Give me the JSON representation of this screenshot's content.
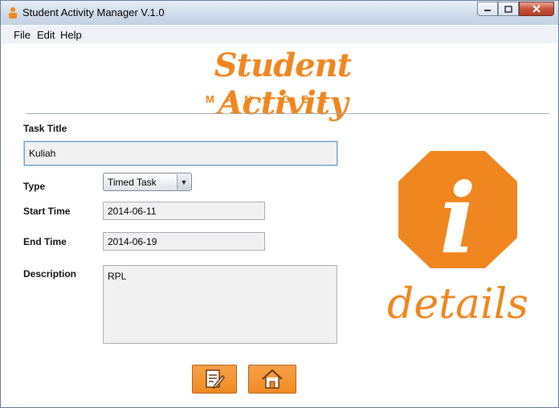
{
  "window": {
    "title": "Student Activity Manager V.1.0"
  },
  "menu": {
    "items": [
      "File",
      "Edit",
      "Help"
    ]
  },
  "logo": {
    "title": "Student Activity",
    "subtitle": "MANAGER"
  },
  "form": {
    "task_title_label": "Task Title",
    "task_title_value": "Kuliah",
    "type_label": "Type",
    "type_value": "Timed Task",
    "start_time_label": "Start Time",
    "start_time_value": "2014-06-11",
    "end_time_label": "End Time",
    "end_time_value": "2014-06-19",
    "description_label": "Description",
    "description_value": "RPL"
  },
  "details_graphic": {
    "letter": "i",
    "word": "details"
  },
  "colors": {
    "accent": "#f0861f"
  },
  "icons": {
    "edit": "edit-document-icon",
    "home": "home-icon"
  }
}
